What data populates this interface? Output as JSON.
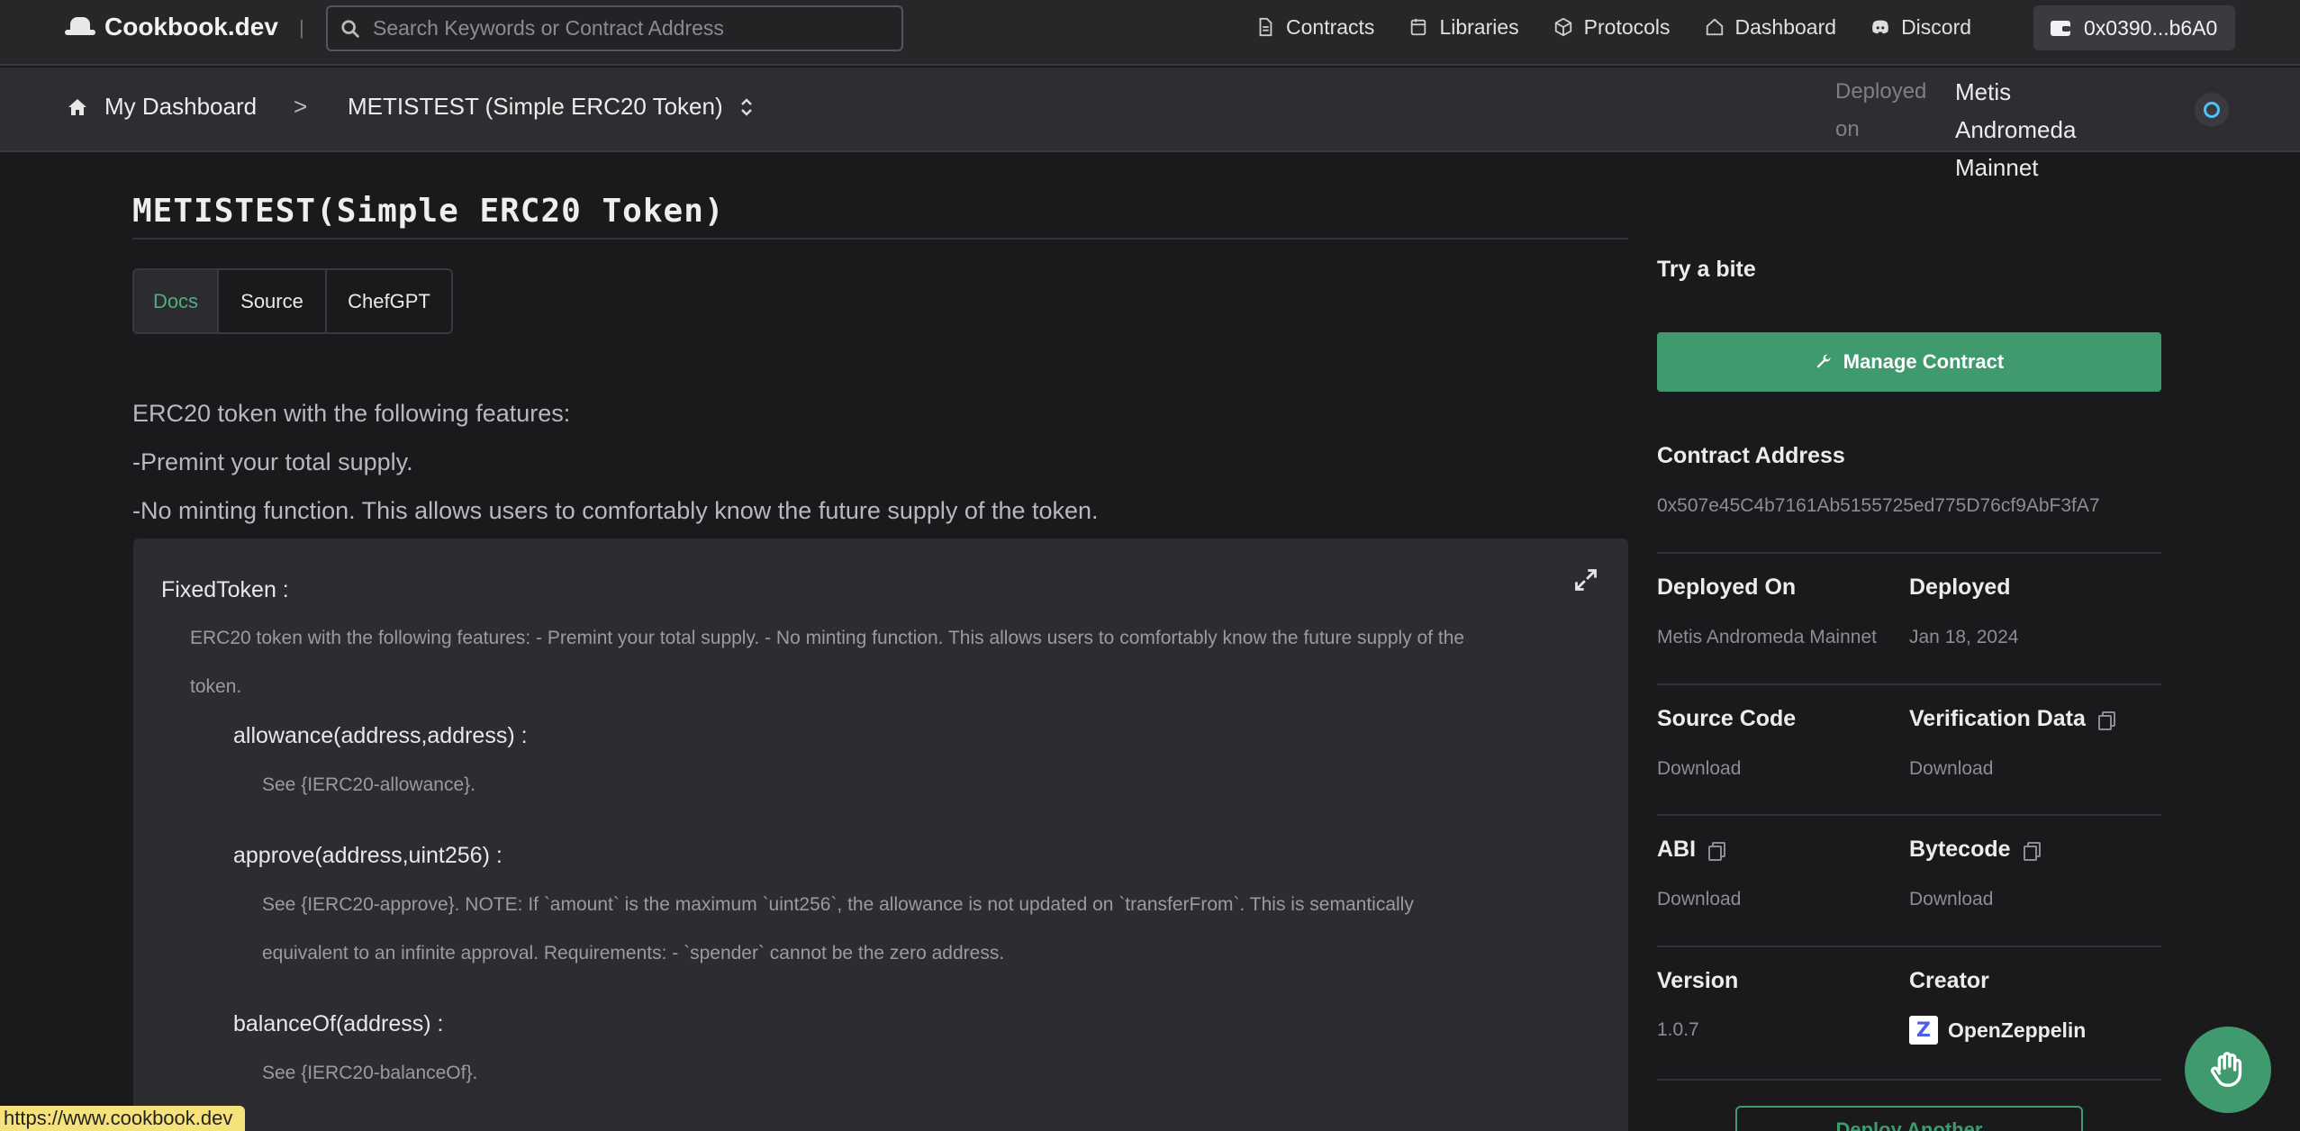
{
  "header": {
    "logo": "Cookbook.dev",
    "separator": "|",
    "search_placeholder": "Search Keywords or Contract Address",
    "nav": [
      {
        "label": "Contracts",
        "icon": "document-icon"
      },
      {
        "label": "Libraries",
        "icon": "library-icon"
      },
      {
        "label": "Protocols",
        "icon": "cube-icon"
      },
      {
        "label": "Dashboard",
        "icon": "home-icon"
      },
      {
        "label": "Discord",
        "icon": "discord-icon"
      }
    ],
    "wallet": "0x0390...b6A0"
  },
  "subnav": {
    "home": "My Dashboard",
    "chevron": ">",
    "contract": "METISTEST (Simple ERC20 Token)",
    "deployed_label": "Deployed on",
    "network": "Metis Andromeda Mainnet"
  },
  "main": {
    "title": "METISTEST(Simple ERC20 Token)",
    "tabs": [
      "Docs",
      "Source",
      "ChefGPT"
    ],
    "intro": [
      "ERC20 token with the following features:",
      "-Premint your total supply.",
      "-No minting function. This allows users to comfortably know the future supply of the token."
    ],
    "doc": {
      "contract": "FixedToken :",
      "contract_desc_1": "ERC20 token with the following features:  - Premint your total supply.  - No minting function. This allows users to comfortably know the future supply of the",
      "contract_desc_2": "token.",
      "functions": [
        {
          "sig": "allowance(address,address) :",
          "desc": [
            "See {IERC20-allowance}."
          ]
        },
        {
          "sig": "approve(address,uint256) :",
          "desc": [
            "See {IERC20-approve}. NOTE: If `amount` is the maximum `uint256`, the allowance is not updated on `transferFrom`. This is semantically",
            "equivalent to an infinite approval. Requirements: - `spender` cannot be the zero address."
          ]
        },
        {
          "sig": "balanceOf(address) :",
          "desc": [
            "See {IERC20-balanceOf}."
          ]
        }
      ]
    }
  },
  "panel": {
    "try": "Try a bite",
    "manage": "Manage Contract",
    "address_label": "Contract Address",
    "address": "0x507e45C4b7161Ab5155725ed775D76cf9AbF3fA7",
    "deployed_on_label": "Deployed On",
    "deployed_on": "Metis Andromeda Mainnet",
    "deployed_label": "Deployed",
    "deployed": "Jan 18, 2024",
    "source_label": "Source Code",
    "source": "Download",
    "verif_label": "Verification Data",
    "verif": "Download",
    "abi_label": "ABI",
    "abi": "Download",
    "bytecode_label": "Bytecode",
    "bytecode": "Download",
    "version_label": "Version",
    "version": "1.0.7",
    "creator_label": "Creator",
    "creator": "OpenZeppelin",
    "creator_logo": "Z",
    "deploy_another": "Deploy Another"
  },
  "status_url": "https://www.cookbook.dev"
}
